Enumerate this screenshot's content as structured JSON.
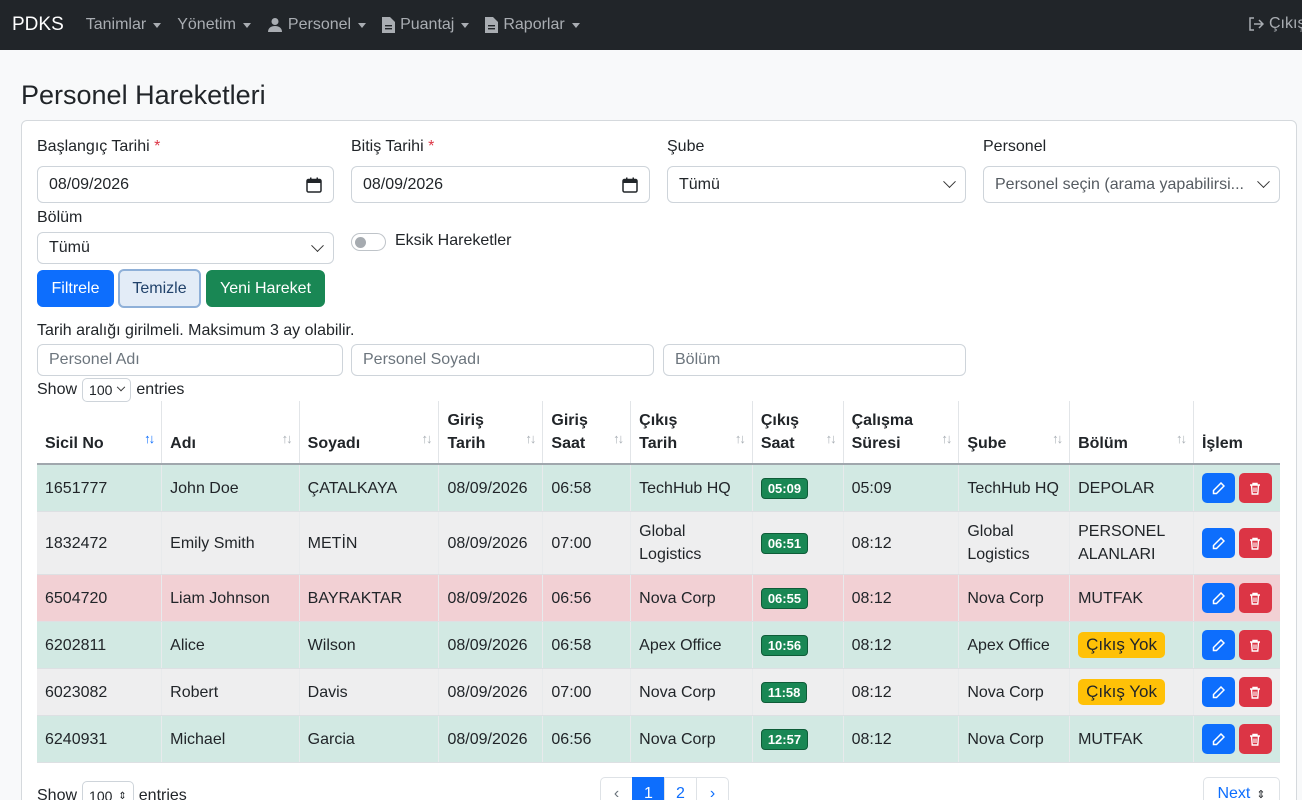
{
  "navbar": {
    "brand": "PDKS",
    "items": [
      {
        "label": "Tanimlar",
        "icon": ""
      },
      {
        "label": "Yönetim",
        "icon": ""
      },
      {
        "label": "Personel",
        "icon": "user-icon"
      },
      {
        "label": "Puantaj",
        "icon": "document-icon"
      },
      {
        "label": "Raporlar",
        "icon": "document-icon"
      }
    ],
    "logout_label": "Çıkış",
    "logout_icon": "logout-icon"
  },
  "page": {
    "title": "Personel Hareketleri"
  },
  "filters": {
    "start_date_label": "Başlangıç Tarihi",
    "start_date_value": "08/09/2026",
    "end_date_label": "Bitiş Tarihi",
    "end_date_value": "08/09/2026",
    "required_mark": "*",
    "branch_label": "Şube",
    "branch_value": "Tümü",
    "personnel_label": "Personel",
    "personnel_placeholder": "Personel seçin (arama yapabilirsi...",
    "department_label": "Bölüm",
    "department_value": "Tümü",
    "missing_toggle_label": "Eksik Hareketler",
    "missing_toggle_on": false
  },
  "buttons": {
    "filter": "Filtrele",
    "clear": "Temizle",
    "new": "Yeni Hareket"
  },
  "info_text": "Tarih aralığı girilmeli. Maksimum 3 ay olabilir.",
  "search": {
    "first_name_placeholder": "Personel Adı",
    "last_name_placeholder": "Personel Soyadı",
    "department_placeholder": "Bölüm"
  },
  "length": {
    "show": "Show",
    "entries": "entries",
    "value": "100"
  },
  "table": {
    "headers": [
      "Sicil No",
      "Adı",
      "Soyadı",
      "Giriş\nTarih",
      "Giriş\nSaat",
      "Çıkış\nTarih",
      "Çıkış\nSaat",
      "Çalışma\nSüresi",
      "Şube",
      "Bölüm",
      "İşlem"
    ],
    "rows": [
      {
        "status": "green",
        "sicil": "1651777",
        "ad": "John Doe",
        "soyad": "ÇATALKAYA",
        "giris_tarih": "08/09/2026",
        "giris_saat": "06:58",
        "cikis_tarih": "TechHub HQ",
        "cikis_saat": "05:09",
        "sure": "05:09",
        "sube": "TechHub HQ",
        "bolum": "DEPOLAR",
        "bolum_warn": false
      },
      {
        "status": "gray",
        "sicil": "1832472",
        "ad": "Emily Smith",
        "soyad": "METİN",
        "giris_tarih": "08/09/2026",
        "giris_saat": "07:00",
        "cikis_tarih": "Global Logistics",
        "cikis_saat": "06:51",
        "sure": "08:12",
        "sube": "Global Logistics",
        "bolum": "PERSONEL ALANLARI",
        "bolum_warn": false
      },
      {
        "status": "red",
        "sicil": "6504720",
        "ad": "Liam Johnson",
        "soyad": "BAYRAKTAR",
        "giris_tarih": "08/09/2026",
        "giris_saat": "06:56",
        "cikis_tarih": "Nova Corp",
        "cikis_saat": "06:55",
        "sure": "08:12",
        "sube": "Nova Corp",
        "bolum": "MUTFAK",
        "bolum_warn": false
      },
      {
        "status": "green",
        "sicil": "6202811",
        "ad": "Alice",
        "soyad": "Wilson",
        "giris_tarih": "08/09/2026",
        "giris_saat": "06:58",
        "cikis_tarih": "Apex Office",
        "cikis_saat": "10:56",
        "sure": "08:12",
        "sube": "Apex Office",
        "bolum": "Çıkış Yok",
        "bolum_warn": true
      },
      {
        "status": "gray",
        "sicil": "6023082",
        "ad": "Robert",
        "soyad": "Davis",
        "giris_tarih": "08/09/2026",
        "giris_saat": "07:00",
        "cikis_tarih": "Nova Corp",
        "cikis_saat": "11:58",
        "sure": "08:12",
        "sube": "Nova Corp",
        "bolum": "Çıkış Yok",
        "bolum_warn": true
      },
      {
        "status": "green",
        "sicil": "6240931",
        "ad": "Michael",
        "soyad": "Garcia",
        "giris_tarih": "08/09/2026",
        "giris_saat": "06:56",
        "cikis_tarih": "Nova Corp",
        "cikis_saat": "12:57",
        "sure": "08:12",
        "sube": "Nova Corp",
        "bolum": "MUTFAK",
        "bolum_warn": false
      }
    ]
  },
  "pagination": {
    "prev": "‹",
    "pages": [
      "1",
      "2"
    ],
    "active_page": "1",
    "next_arrow": "›",
    "next_label": "Next"
  },
  "colors": {
    "primary": "#0d6efd",
    "success": "#198754",
    "danger": "#dc3545",
    "warning": "#ffc107",
    "row_green": "#d2e9e3",
    "row_gray": "#eeeeef",
    "row_red": "#f2d0d4"
  }
}
